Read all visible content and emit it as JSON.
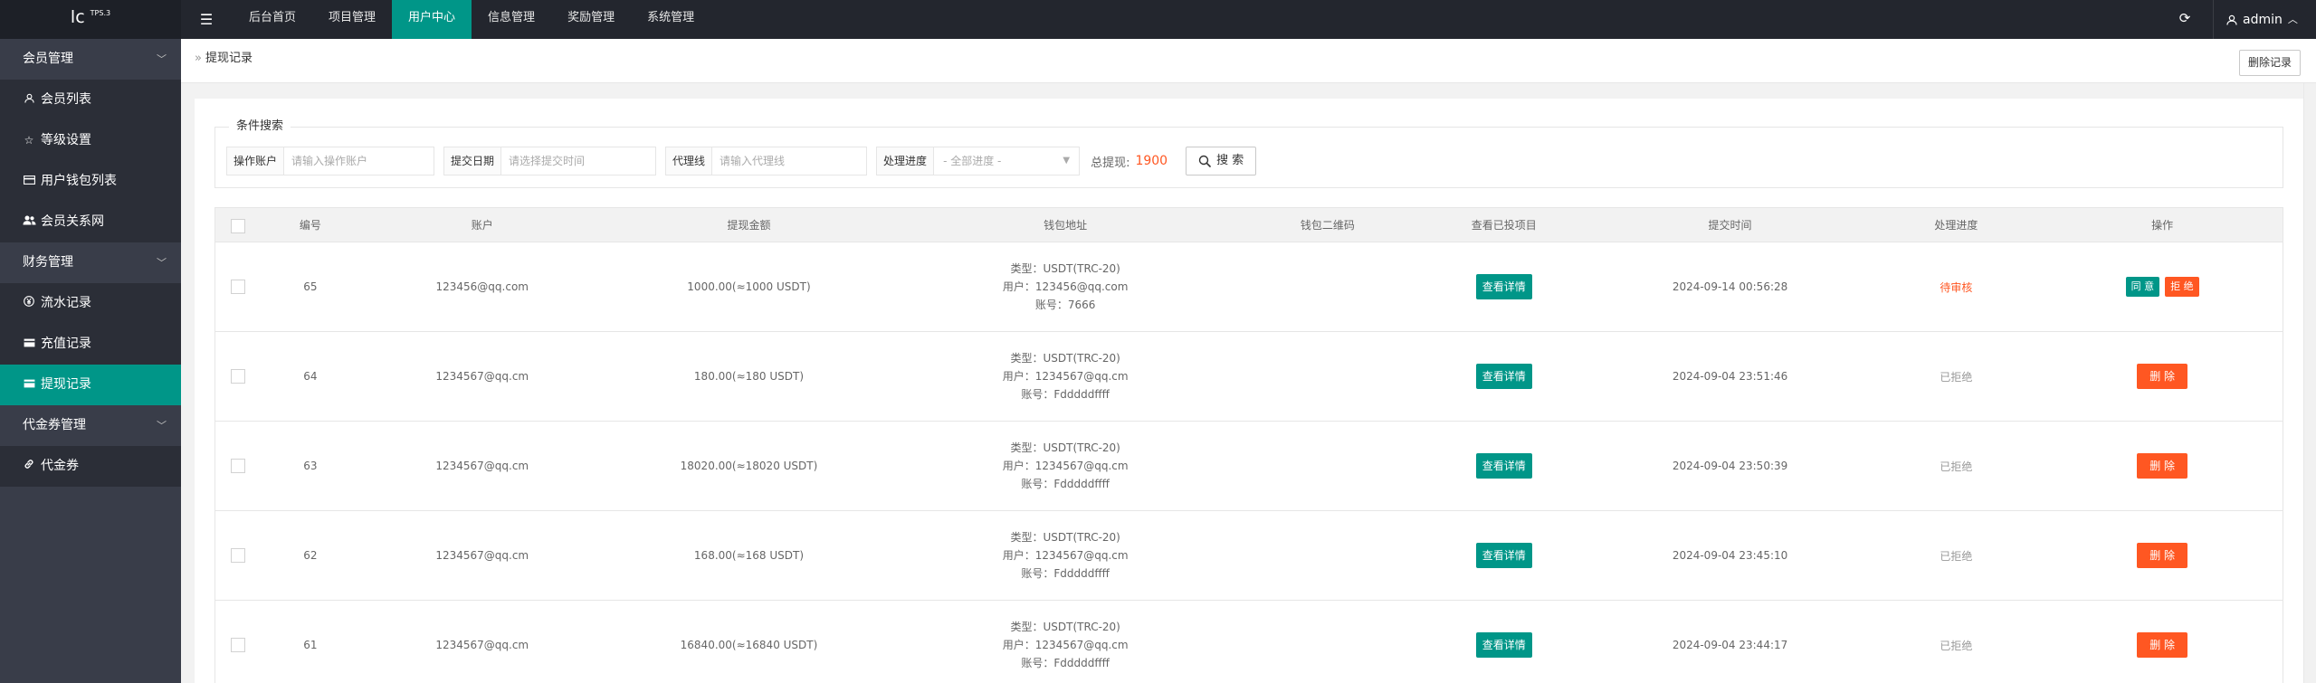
{
  "header": {
    "logo_text": "lc",
    "logo_sup": "TPS.3",
    "nav": [
      "后台首页",
      "项目管理",
      "用户中心",
      "信息管理",
      "奖励管理",
      "系统管理"
    ],
    "user": "admin"
  },
  "sidebar": {
    "groups": [
      {
        "label": "会员管理",
        "items": [
          {
            "label": "会员列表",
            "icon": "user-icon"
          },
          {
            "label": "等级设置",
            "icon": "star-icon"
          },
          {
            "label": "用户钱包列表",
            "icon": "card-icon"
          },
          {
            "label": "会员关系网",
            "icon": "users-icon"
          }
        ]
      },
      {
        "label": "财务管理",
        "items": [
          {
            "label": "流水记录",
            "icon": "yen-icon"
          },
          {
            "label": "充值记录",
            "icon": "card-icon"
          },
          {
            "label": "提现记录",
            "icon": "card-icon"
          }
        ]
      },
      {
        "label": "代金券管理",
        "items": [
          {
            "label": "代金券",
            "icon": "link-icon"
          }
        ]
      }
    ]
  },
  "breadcrumb": "提现记录",
  "delete_records_label": "删除记录",
  "search": {
    "legend": "条件搜索",
    "account_label": "操作账户",
    "account_placeholder": "请输入操作账户",
    "date_label": "提交日期",
    "date_placeholder": "请选择提交时间",
    "agent_label": "代理线",
    "agent_placeholder": "请输入代理线",
    "progress_label": "处理进度",
    "progress_value": "- 全部进度 -",
    "total_label": "总提现:",
    "total_value": "1900",
    "search_button": "搜 索"
  },
  "table": {
    "columns": [
      "编号",
      "账户",
      "提现金额",
      "钱包地址",
      "钱包二维码",
      "查看已投项目",
      "提交时间",
      "处理进度",
      "操作"
    ],
    "view_label": "查看详情",
    "agree_label": "同 意",
    "reject_label": "拒 绝",
    "delete_label": "删 除",
    "rows": [
      {
        "id": "65",
        "account": "123456@qq.com",
        "amount": "1000.00(≈1000 USDT)",
        "wallet_type": "类型：USDT(TRC-20)",
        "wallet_user": "用户：123456@qq.com",
        "wallet_no": "账号：7666",
        "time": "2024-09-14 00:56:28",
        "status": "待审核",
        "pending": true
      },
      {
        "id": "64",
        "account": "1234567@qq.cm",
        "amount": "180.00(≈180 USDT)",
        "wallet_type": "类型：USDT(TRC-20)",
        "wallet_user": "用户：1234567@qq.cm",
        "wallet_no": "账号：Fdddddffff",
        "time": "2024-09-04 23:51:46",
        "status": "已拒绝",
        "pending": false
      },
      {
        "id": "63",
        "account": "1234567@qq.cm",
        "amount": "18020.00(≈18020 USDT)",
        "wallet_type": "类型：USDT(TRC-20)",
        "wallet_user": "用户：1234567@qq.cm",
        "wallet_no": "账号：Fdddddffff",
        "time": "2024-09-04 23:50:39",
        "status": "已拒绝",
        "pending": false
      },
      {
        "id": "62",
        "account": "1234567@qq.cm",
        "amount": "168.00(≈168 USDT)",
        "wallet_type": "类型：USDT(TRC-20)",
        "wallet_user": "用户：1234567@qq.cm",
        "wallet_no": "账号：Fdddddffff",
        "time": "2024-09-04 23:45:10",
        "status": "已拒绝",
        "pending": false
      },
      {
        "id": "61",
        "account": "1234567@qq.cm",
        "amount": "16840.00(≈16840 USDT)",
        "wallet_type": "类型：USDT(TRC-20)",
        "wallet_user": "用户：1234567@qq.cm",
        "wallet_no": "账号：Fdddddffff",
        "time": "2024-09-04 23:44:17",
        "status": "已拒绝",
        "pending": false
      }
    ]
  },
  "colors": {
    "accent": "#009688",
    "danger": "#ff5722",
    "sidebar": "#393d49",
    "header": "#23262e"
  }
}
